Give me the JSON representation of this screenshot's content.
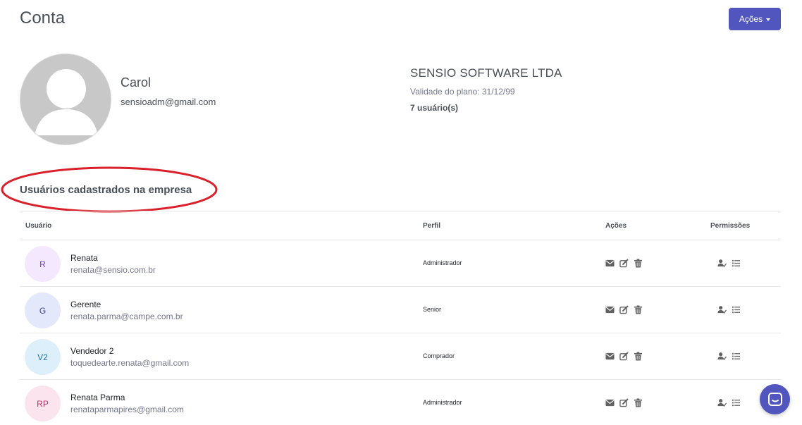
{
  "page": {
    "title": "Conta"
  },
  "header": {
    "actions_label": "Ações"
  },
  "profile": {
    "name": "Carol",
    "email": "sensioadm@gmail.com"
  },
  "company": {
    "name": "SENSIO SOFTWARE LTDA",
    "plan_validity": "Validade do plano: 31/12/99",
    "user_count": "7 usuário(s)"
  },
  "users_section": {
    "title": "Usuários cadastrados na empresa"
  },
  "table": {
    "headers": {
      "user": "Usuário",
      "profile": "Perfil",
      "actions": "Ações",
      "permissions": "Permissões"
    },
    "rows": [
      {
        "initials": "R",
        "name": "Renata",
        "email": "renata@sensio.com.br",
        "profile": "Administrador",
        "avatar_bg": "#f3e8fd",
        "avatar_color": "#6f42c1"
      },
      {
        "initials": "G",
        "name": "Gerente",
        "email": "renata.parma@campe.com.br",
        "profile": "Senior",
        "avatar_bg": "#e4e8fb",
        "avatar_color": "#3b4a9a"
      },
      {
        "initials": "V2",
        "name": "Vendedor 2",
        "email": "toquedearte.renata@gmail.com",
        "profile": "Comprador",
        "avatar_bg": "#ddeffb",
        "avatar_color": "#2a6f97"
      },
      {
        "initials": "RP",
        "name": "Renata Parma",
        "email": "renataparmapires@gmail.com",
        "profile": "Administrador",
        "avatar_bg": "#fce4ef",
        "avatar_color": "#b03a6b"
      }
    ]
  },
  "colors": {
    "primary": "#5156be",
    "annotation": "#d9202b",
    "text": "#495057",
    "muted": "#74788d"
  },
  "icons": {
    "row_actions": [
      "envelope-icon",
      "edit-icon",
      "trash-icon"
    ],
    "row_permissions": [
      "user-check-icon",
      "list-icon"
    ],
    "chat": "chat-bubble-icon"
  }
}
